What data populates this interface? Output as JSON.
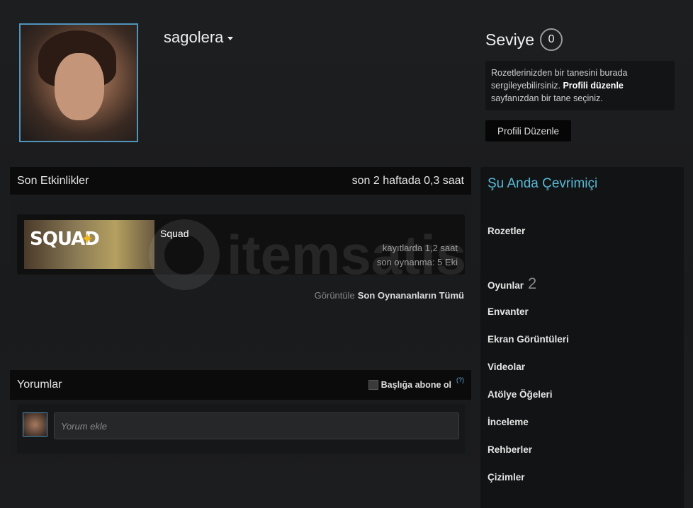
{
  "profile": {
    "username": "sagolera",
    "level_label": "Seviye",
    "level": "0"
  },
  "badge_box": {
    "text1": "Rozetlerinizden bir tanesini burada sergileyebilirsiniz.",
    "link": "Profili düzenle",
    "text2": "sayfanızdan bir tane seçiniz."
  },
  "edit_button": "Profili Düzenle",
  "activity": {
    "title": "Son Etkinlikler",
    "summary": "son 2 haftada 0,3 saat",
    "game": {
      "name": "Squad",
      "logo_text": "SQUAD",
      "total": "kayıtlarda 1,2 saat",
      "last_played": "son oynanma: 5 Eki"
    },
    "view_label": "Görüntüle",
    "view_all": "Son Oynananların Tümü"
  },
  "comments": {
    "title": "Yorumlar",
    "subscribe": "Başlığa abone ol",
    "help": "(?)",
    "placeholder": "Yorum ekle"
  },
  "sidebar": {
    "status": "Şu Anda Çevrimiçi",
    "links": [
      {
        "label": "Rozetler"
      },
      {
        "label": "Oyunlar",
        "count": "2"
      },
      {
        "label": "Envanter"
      },
      {
        "label": "Ekran Görüntüleri"
      },
      {
        "label": "Videolar"
      },
      {
        "label": "Atölye Öğeleri"
      },
      {
        "label": "İnceleme"
      },
      {
        "label": "Rehberler"
      },
      {
        "label": "Çizimler"
      }
    ]
  },
  "watermark": "itemsatis"
}
